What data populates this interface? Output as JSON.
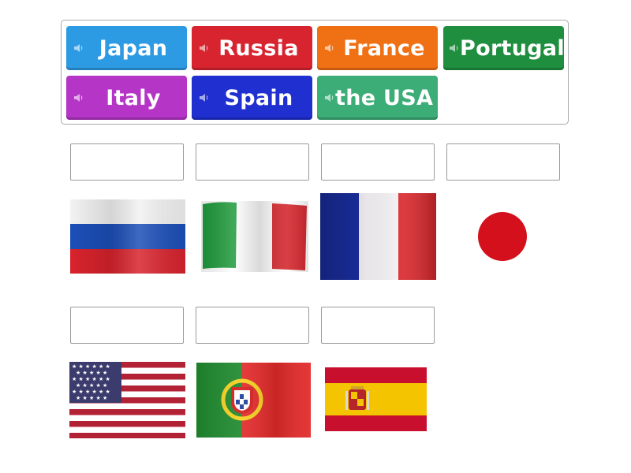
{
  "activity": {
    "type": "Match up"
  },
  "word_bank": {
    "tiles": [
      {
        "label": "Japan",
        "color": "#2c9be3"
      },
      {
        "label": "Russia",
        "color": "#d8242f"
      },
      {
        "label": "France",
        "color": "#f07014"
      },
      {
        "label": "Portugal",
        "color": "#1f8f3f"
      },
      {
        "label": "Italy",
        "color": "#b535c6"
      },
      {
        "label": "Spain",
        "color": "#1f2fd0"
      },
      {
        "label": "the USA",
        "color": "#3cad77"
      }
    ],
    "icon": "speaker-icon"
  },
  "answer_slots": [
    {
      "flag": "flag-russia",
      "value": ""
    },
    {
      "flag": "flag-italy",
      "value": ""
    },
    {
      "flag": "flag-france",
      "value": ""
    },
    {
      "flag": "flag-japan",
      "value": ""
    },
    {
      "flag": "flag-usa",
      "value": ""
    },
    {
      "flag": "flag-portugal",
      "value": ""
    },
    {
      "flag": "flag-spain",
      "value": ""
    }
  ]
}
